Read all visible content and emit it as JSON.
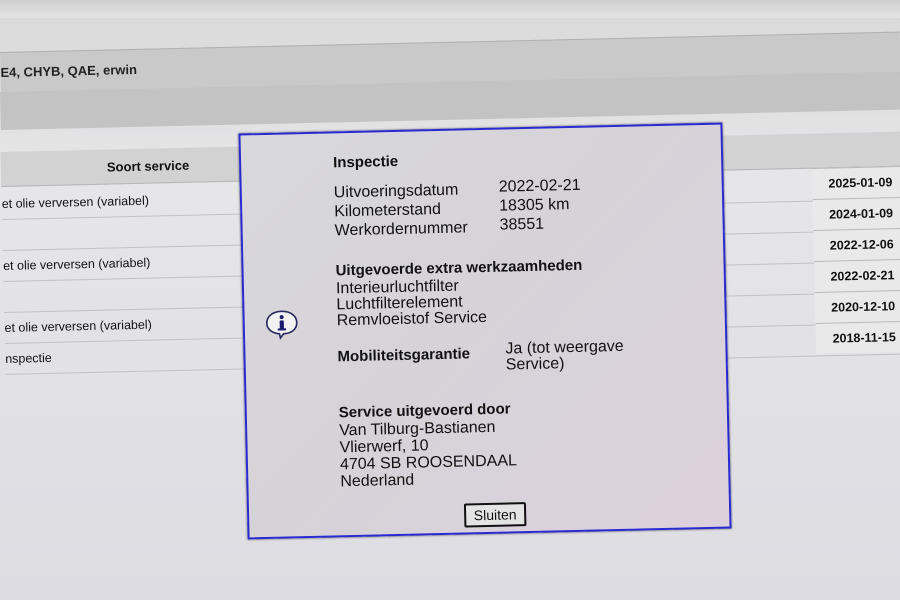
{
  "header": {
    "session_text": "E4, CHYB, QAE, erwin"
  },
  "table": {
    "column_service": "Soort service",
    "rows": [
      {
        "service": "et olie verversen (variabel)"
      },
      {
        "service": ""
      },
      {
        "service": "et olie verversen (variabel)"
      },
      {
        "service": ""
      },
      {
        "service": "et olie verversen (variabel)"
      },
      {
        "service": "nspectie"
      }
    ],
    "dates": [
      "2025-01-09",
      "2024-01-09",
      "2022-12-06",
      "2022-02-21",
      "2020-12-10",
      "2018-11-15"
    ]
  },
  "dialog": {
    "title": "Inspectie",
    "fields": [
      {
        "label": "Uitvoeringsdatum",
        "value": "2022-02-21"
      },
      {
        "label": "Kilometerstand",
        "value": "18305 km"
      },
      {
        "label": "Werkordernummer",
        "value": "38551"
      }
    ],
    "extra_title": "Uitgevoerde extra werkzaamheden",
    "extra_items": [
      "Interieurluchtfilter",
      "Luchtfilterelement",
      "Remvloeistof Service"
    ],
    "mobility_label": "Mobiliteitsgarantie",
    "mobility_value_line1": "Ja (tot weergave",
    "mobility_value_line2": "Service)",
    "dealer_title": "Service uitgevoerd door",
    "dealer_lines": [
      "Van Tilburg-Bastianen",
      "Vlierwerf, 10",
      "4704 SB ROOSENDAAL",
      "Nederland"
    ],
    "close_label": "Sluiten",
    "icon": "info-icon"
  },
  "colors": {
    "dialog_border": "#2a2ad0"
  }
}
